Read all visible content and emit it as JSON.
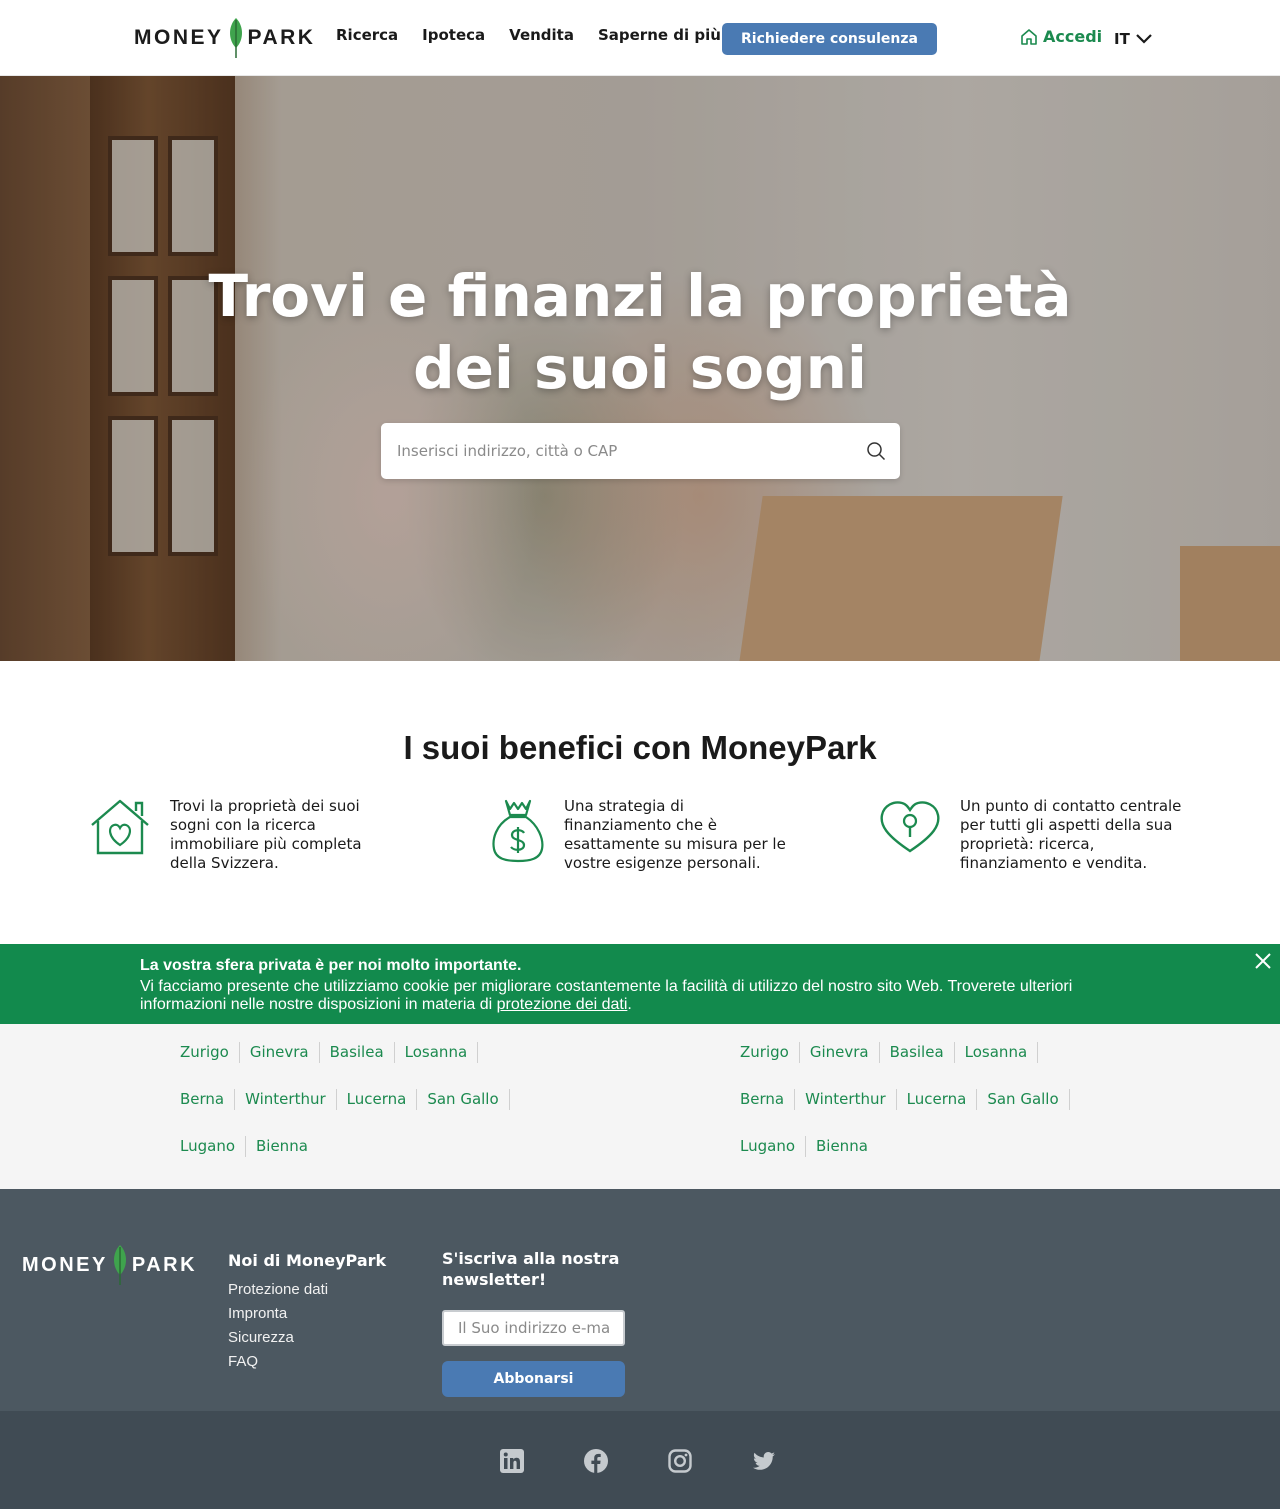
{
  "header": {
    "logo_left": "MONEY",
    "logo_right": "PARK",
    "nav": [
      "Ricerca",
      "Ipoteca",
      "Vendita",
      "Saperne di più"
    ],
    "cta_label": "Richiedere consulenza",
    "login_label": "Accedi",
    "lang_label": "IT"
  },
  "hero": {
    "title_line1": "Trovi e finanzi la proprietà",
    "title_line2": "dei suoi sogni",
    "search_placeholder": "Inserisci indirizzo, città o CAP"
  },
  "benefits": {
    "title": "I suoi benefici con MoneyPark",
    "items": [
      {
        "icon": "house-heart-icon",
        "text": "Trovi la proprietà dei suoi sogni con la ricerca immobiliare più completa della Svizzera."
      },
      {
        "icon": "money-bag-icon",
        "text": "Una strategia di finanziamento che è esattamente su misura per le vostre esigenze personali."
      },
      {
        "icon": "heart-keyhole-icon",
        "text": "Un punto di contatto centrale per tutti gli aspetti della sua proprietà: ricerca, finanziamento e vendita."
      }
    ]
  },
  "cookie": {
    "title": "La vostra sfera privata è per noi molto importante.",
    "text": "Vi facciamo presente che utilizziamo cookie per migliorare costantemente la facilità di utilizzo del nostro sito Web. Troverete ulteriori informazioni nelle nostre disposizioni in materia di",
    "link": "protezione dei dati",
    "end": "."
  },
  "cities": {
    "left": [
      "Zurigo",
      "Ginevra",
      "Basilea",
      "Losanna",
      "Berna",
      "Winterthur",
      "Lucerna",
      "San Gallo",
      "Lugano",
      "Bienna"
    ],
    "right": [
      "Zurigo",
      "Ginevra",
      "Basilea",
      "Losanna",
      "Berna",
      "Winterthur",
      "Lucerna",
      "San Gallo",
      "Lugano",
      "Bienna"
    ]
  },
  "footer": {
    "col_title": "Noi di MoneyPark",
    "links": [
      "Protezione dati",
      "Impronta",
      "Sicurezza",
      "FAQ"
    ],
    "newsletter_title": "S'iscriva alla nostra newsletter!",
    "email_placeholder": "Il Suo indirizzo e-mail",
    "subscribe_label": "Abbonarsi"
  },
  "social": [
    "linkedin-icon",
    "facebook-icon",
    "instagram-icon",
    "twitter-icon"
  ],
  "colors": {
    "brand_green": "#1c8a4f",
    "cta_blue": "#4a7ab3",
    "footer_bg": "#4c5861",
    "bottom_bg": "#404b54",
    "cookie_bg": "#128a4d"
  }
}
